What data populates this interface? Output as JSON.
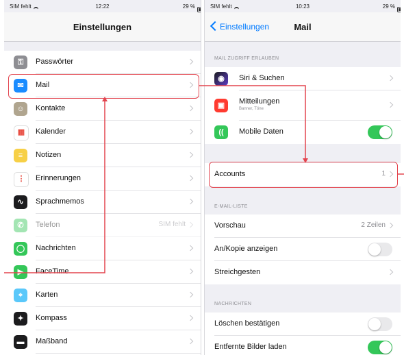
{
  "left": {
    "status": {
      "carrier": "SIM fehlt",
      "time": "12:22",
      "battery": "29 %"
    },
    "title": "Einstellungen",
    "items": [
      {
        "label": "Passwörter",
        "icon": "key-icon",
        "color": "#8e8e93"
      },
      {
        "label": "Mail",
        "icon": "mail-icon",
        "color": "#1a8cff"
      },
      {
        "label": "Kontakte",
        "icon": "contacts-icon",
        "color": "#b0a58f"
      },
      {
        "label": "Kalender",
        "icon": "calendar-icon",
        "color": "#ffffff"
      },
      {
        "label": "Notizen",
        "icon": "notes-icon",
        "color": "#f7d047"
      },
      {
        "label": "Erinnerungen",
        "icon": "reminders-icon",
        "color": "#ffffff"
      },
      {
        "label": "Sprachmemos",
        "icon": "voice-memos-icon",
        "color": "#1c1c1e"
      },
      {
        "label": "Telefon",
        "value": "SIM fehlt",
        "icon": "phone-icon",
        "color": "#34c759"
      },
      {
        "label": "Nachrichten",
        "icon": "messages-icon",
        "color": "#34c759"
      },
      {
        "label": "FaceTime",
        "icon": "facetime-icon",
        "color": "#34c759"
      },
      {
        "label": "Karten",
        "icon": "maps-icon",
        "color": "#5ac8fa"
      },
      {
        "label": "Kompass",
        "icon": "compass-icon",
        "color": "#1c1c1e"
      },
      {
        "label": "Maßband",
        "icon": "measure-icon",
        "color": "#1c1c1e"
      }
    ]
  },
  "right": {
    "status": {
      "carrier": "SIM fehlt",
      "time": "10:23",
      "battery": "29 %"
    },
    "back": "Einstellungen",
    "title": "Mail",
    "section1": "MAIL ZUGRIFF ERLAUBEN",
    "siri": "Siri & Suchen",
    "notifications": "Mitteilungen",
    "notifications_sub": "Banner, Töne",
    "mobile_data": "Mobile Daten",
    "mobile_data_on": true,
    "accounts": "Accounts",
    "accounts_count": "1",
    "section2": "E-MAIL-LISTE",
    "preview": "Vorschau",
    "preview_value": "2 Zeilen",
    "cc": "An/Kopie anzeigen",
    "cc_on": false,
    "swipe": "Streichgesten",
    "section3": "NACHRICHTEN",
    "confirm_delete": "Löschen bestätigen",
    "confirm_delete_on": false,
    "load_images": "Entfernte Bilder laden",
    "load_images_on": true
  },
  "annotation_color": "#e3454f"
}
